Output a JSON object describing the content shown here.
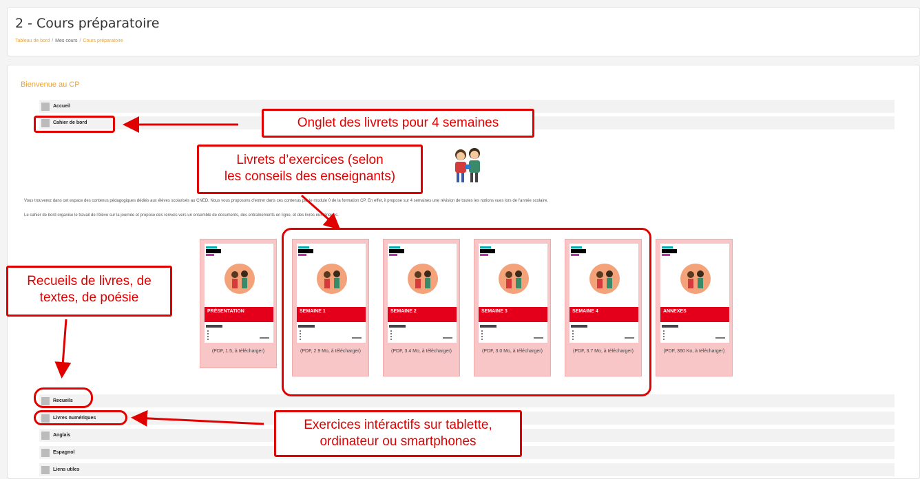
{
  "page": {
    "title": "2 - Cours préparatoire",
    "breadcrumb": [
      "Tableau de bord",
      "Mes cours",
      "Cours préparatoire"
    ]
  },
  "course": {
    "section_title": "Bienvenue au CP",
    "top_sections": [
      "Accueil",
      "Cahier de bord"
    ],
    "bottom_sections": [
      "Recueils",
      "Livres numériques",
      "Anglais",
      "Espagnol",
      "Liens utiles"
    ],
    "description": [
      "Vous trouverez dans cet espace des contenus pédagogiques dédiés aux élèves scolarisés au CNED. Nous vous proposons d'entrer dans ces contenus par le module 0 de la formation CP. En effet, il propose sur 4 semaines une révision de toutes les notions vues lors de l'année scolaire.",
      "Le cahier de bord organise le travail de l'élève sur la journée et propose des renvois vers un ensemble de documents, des entraînements en ligne, et des livres numériques."
    ],
    "booklets": [
      {
        "label": "PRÉSENTATION",
        "caption": "(PDF, 1.5, à télécharger)"
      },
      {
        "label": "SEMAINE 1",
        "caption": "(PDF, 2.9 Mo, à télécharger)"
      },
      {
        "label": "SEMAINE 2",
        "caption": "(PDF, 3.4 Mo, à télécharger)"
      },
      {
        "label": "SEMAINE 3",
        "caption": "(PDF, 3.0 Mo, à télécharger)"
      },
      {
        "label": "SEMAINE 4",
        "caption": "(PDF, 3.7 Mo, à télécharger)"
      },
      {
        "label": "ANNEXES",
        "caption": "(PDF, 360 Ko, à télécharger)"
      }
    ]
  },
  "annotations": {
    "onglet": "Onglet des livrets pour 4 semaines",
    "livrets_line1": "Livrets d’exercices (selon",
    "livrets_line2": "les conseils des enseignants)",
    "recueils_line1": "Recueils de livres, de",
    "recueils_line2": "textes, de poésie",
    "exercices_line1": "Exercices intéractifs sur tablette,",
    "exercices_line2": "ordinateur ou smartphones"
  },
  "colors": {
    "annotation_red": "#e10000",
    "breadcrumb_link": "#e8a33b",
    "booklet_band": "#e4001b",
    "booklet_bg": "#f8c6c6"
  }
}
